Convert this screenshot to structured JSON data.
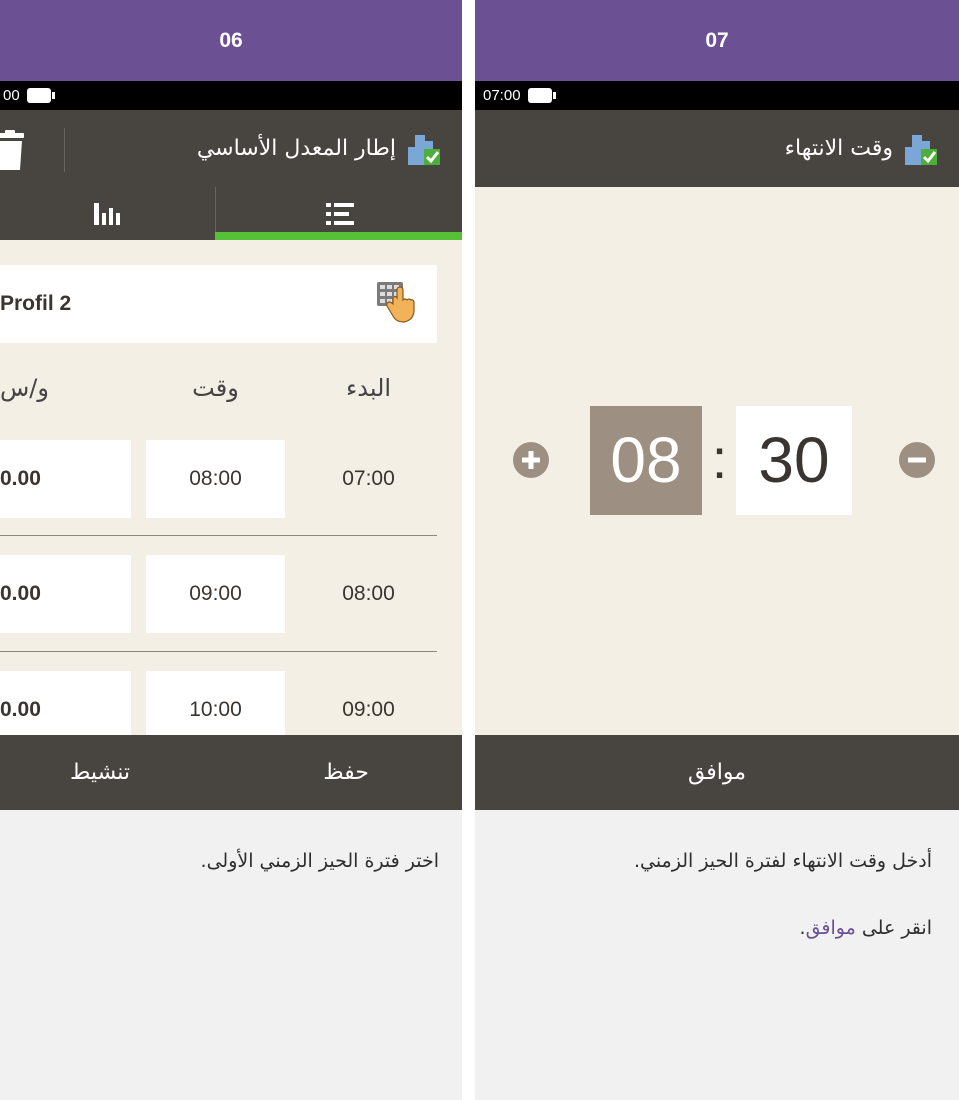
{
  "screen06": {
    "step": "06",
    "status_time": "00",
    "title": "إطار المعدل الأساسي",
    "tabs": {
      "chart_icon": "bar-chart-icon",
      "list_icon": "list-icon",
      "active": "list"
    },
    "profile": "Profil 2",
    "columns": {
      "start": "البدء",
      "end": "وقت",
      "rate": "و/س"
    },
    "rows": [
      {
        "start": "07:00",
        "end": "08:00",
        "rate": "0.00"
      },
      {
        "start": "08:00",
        "end": "09:00",
        "rate": "0.00"
      },
      {
        "start": "09:00",
        "end": "10:00",
        "rate": "0.00"
      }
    ],
    "buttons": {
      "save": "حفظ",
      "activate": "تنشيط"
    },
    "instruction": "اختر فترة الحيز الزمني الأولى."
  },
  "screen07": {
    "step": "07",
    "status_time": "07:00",
    "title": "وقت الانتهاء",
    "hours": "08",
    "separator": ":",
    "minutes": "30",
    "ok": "موافق",
    "instruction_1": "أدخل وقت الانتهاء لفترة الحيز الزمني.",
    "instruction_2_prefix": "انقر على ",
    "instruction_2_link": "موافق",
    "instruction_2_suffix": "."
  },
  "colors": {
    "header_purple": "#6b5194",
    "bar_dark": "#48443f",
    "content_beige": "#f3efe4",
    "accent_green": "#56c037",
    "time_brown": "#9d8f81"
  }
}
